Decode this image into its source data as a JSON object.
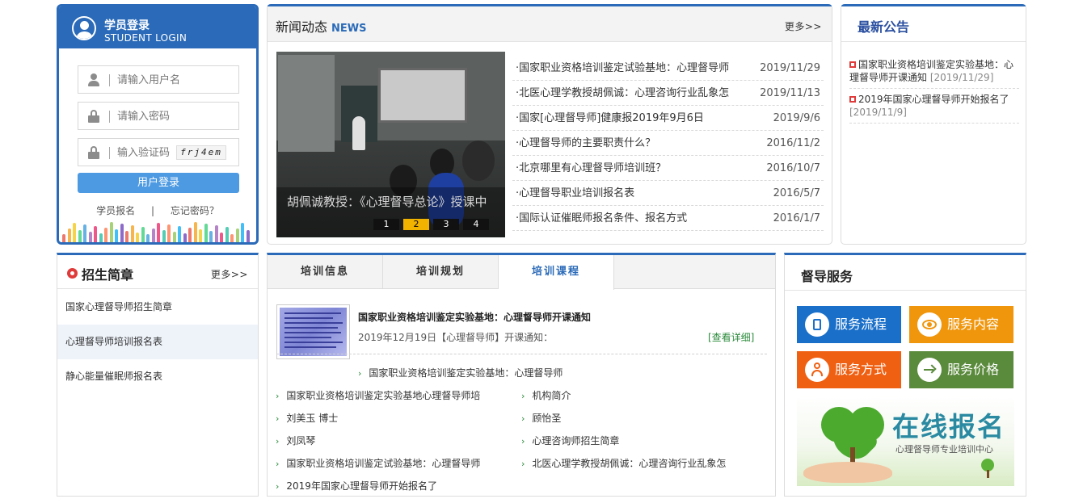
{
  "login": {
    "title_cn": "学员登录",
    "title_en": "STUDENT LOGIN",
    "username_placeholder": "请输入用户名",
    "password_placeholder": "请输入密码",
    "captcha_placeholder": "输入验证码",
    "captcha_text": "frj4em",
    "login_button": "用户登录",
    "register_link": "学员报名",
    "divider": "|",
    "forgot_link": "忘记密码？"
  },
  "news": {
    "title": "新闻动态",
    "title_en": "NEWS",
    "more": "更多>>",
    "photo_caption": "胡佩诚教授：《心理督导总论》授课中",
    "slides": [
      "1",
      "2",
      "3",
      "4"
    ],
    "active_slide": 1,
    "items": [
      {
        "title": "·国家职业资格培训鉴定试验基地：心理督导师",
        "date": "2019/11/29"
      },
      {
        "title": "·北医心理学教授胡佩诚：心理咨询行业乱象怎",
        "date": "2019/11/13"
      },
      {
        "title": "·国家[心理督导师]健康报2019年9月6日",
        "date": "2019/9/6"
      },
      {
        "title": "·心理督导师的主要职责什么？",
        "date": "2016/11/2"
      },
      {
        "title": "·北京哪里有心理督导师培训班？",
        "date": "2016/10/7"
      },
      {
        "title": "·心理督导职业培训报名表",
        "date": "2016/5/7"
      },
      {
        "title": "·国际认证催眠师报名条件、报名方式",
        "date": "2016/1/7"
      }
    ]
  },
  "notice": {
    "title": "最新公告",
    "items": [
      {
        "title": "国家职业资格培训鉴定实验基地：心理督导师开课通知",
        "date": "[2019/11/29]"
      },
      {
        "title": "2019年国家心理督导师开始报名了",
        "date": "[2019/11/9]"
      }
    ]
  },
  "guide": {
    "title": "招生简章",
    "more": "更多>>",
    "items": [
      "国家心理督导师招生简章",
      "心理督导师培训报名表",
      "静心能量催眠师报名表"
    ]
  },
  "training": {
    "tabs": [
      "培训信息",
      "培训规划",
      "培训课程"
    ],
    "active_tab": 2,
    "featured": {
      "title": "国家职业资格培训鉴定实验基地：心理督导师开课通知",
      "summary": "2019年12月19日【心理督导师】开课通知：",
      "detail_link": "[查看详细]"
    },
    "arrow": "›",
    "links_center": [
      "国家职业资格培训鉴定实验基地：心理督导师"
    ],
    "links_left": [
      "国家职业资格培训鉴定实验基地心理督导师培",
      "刘美玉 博士",
      "刘凤琴",
      "国家职业资格培训鉴定试验基地：心理督导师",
      "2019年国家心理督导师开始报名了"
    ],
    "links_right": [
      "机构简介",
      "顾怡圣",
      "心理咨询师招生简章",
      "北医心理学教授胡佩诚：心理咨询行业乱象怎"
    ]
  },
  "services": {
    "title": "督导服务",
    "buttons": [
      {
        "label": "服务流程",
        "color": "#1a6fc9",
        "icon": "list-icon"
      },
      {
        "label": "服务内容",
        "color": "#f0960c",
        "icon": "eye-icon"
      },
      {
        "label": "服务方式",
        "color": "#f06012",
        "icon": "person-icon"
      },
      {
        "label": "服务价格",
        "color": "#5a8a3c",
        "icon": "arrow-icon"
      }
    ],
    "banner_title": "在线报名",
    "banner_subtitle": "心理督导师专业培训中心"
  },
  "colors": {
    "primary": "#2a6ab8",
    "accent_green": "#2a8a3a",
    "active_slide": "#f2b300"
  }
}
